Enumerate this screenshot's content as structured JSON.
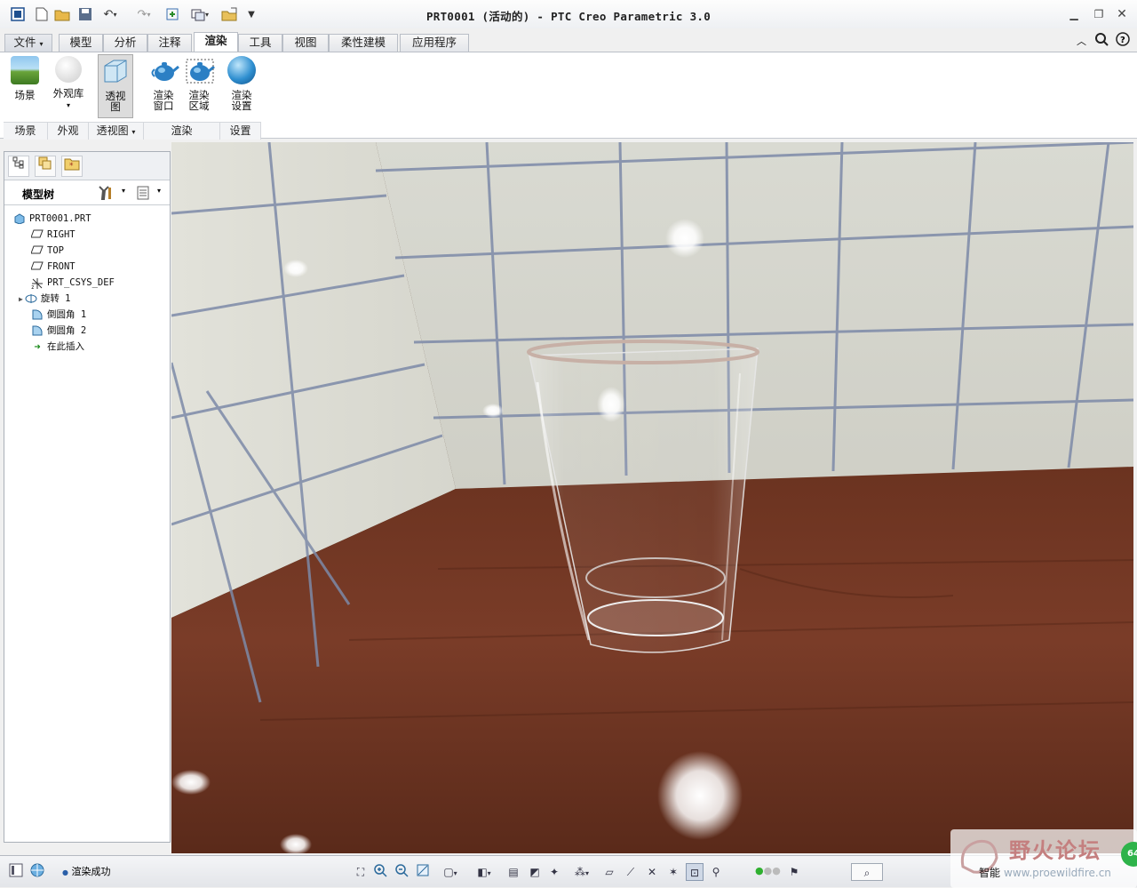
{
  "window": {
    "title": "PRT0001 (活动的) - PTC Creo Parametric 3.0"
  },
  "tabs": [
    "文件",
    "模型",
    "分析",
    "注释",
    "渲染",
    "工具",
    "视图",
    "柔性建模",
    "应用程序"
  ],
  "active_tab": "渲染",
  "ribbon": {
    "buttons": {
      "scene": "场景",
      "appearance": "外观库",
      "perspective": "透视\n图",
      "render_window": "渲染\n窗口",
      "render_region": "渲染\n区域",
      "render_setup": "渲染\n设置"
    },
    "groups": {
      "scene": "场景",
      "appearance": "外观",
      "perspective": "透视图",
      "render": "渲染",
      "setup": "设置"
    }
  },
  "model_tree": {
    "header": "模型树",
    "nodes": [
      "PRT0001.PRT",
      "RIGHT",
      "TOP",
      "FRONT",
      "PRT_CSYS_DEF",
      "旋转 1",
      "倒圆角 1",
      "倒圆角 2",
      "在此插入"
    ]
  },
  "status": {
    "message": "渲染成功",
    "filter": "智能",
    "watermark": "野火论坛",
    "watermark_url": "www.proewildfire.cn",
    "badge": "64"
  }
}
